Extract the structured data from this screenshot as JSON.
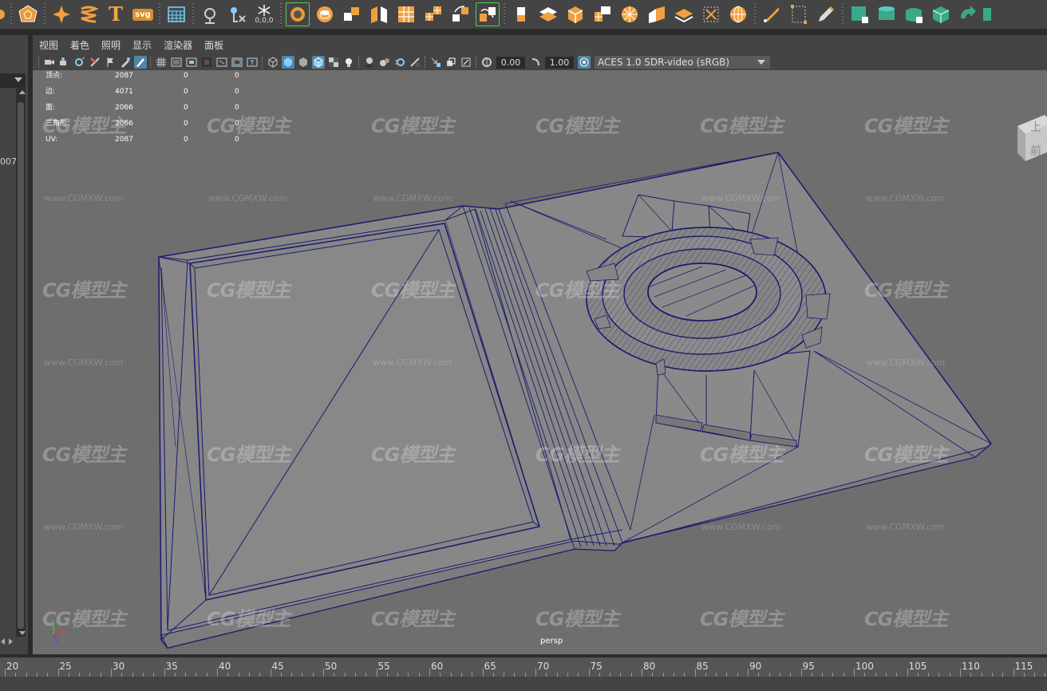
{
  "viewport_menu": [
    "视图",
    "着色",
    "照明",
    "显示",
    "渲染器",
    "面板"
  ],
  "view_fields": {
    "exposure": "0.00",
    "gamma": "1.00",
    "color_space": "ACES 1.0 SDR-video (sRGB)"
  },
  "hud": {
    "rows": [
      {
        "label": "顶点:",
        "v1": "2087",
        "v2": "0",
        "v3": "0"
      },
      {
        "label": "边:",
        "v1": "4071",
        "v2": "0",
        "v3": "0"
      },
      {
        "label": "面:",
        "v1": "2066",
        "v2": "0",
        "v3": "0"
      },
      {
        "label": "三角形:",
        "v1": "2066",
        "v2": "0",
        "v3": "0"
      },
      {
        "label": "UV:",
        "v1": "2087",
        "v2": "0",
        "v3": "0"
      }
    ]
  },
  "camera_label": "persp",
  "left_panel_text": "007",
  "viewcube": {
    "top": "上",
    "front": "前"
  },
  "watermark": {
    "logo": "CG模型主",
    "url": "www.CGMXW.com"
  },
  "timeline": {
    "ticks": [
      "20",
      "25",
      "30",
      "35",
      "40",
      "45",
      "50",
      "55",
      "60",
      "65",
      "70",
      "75",
      "80",
      "85",
      "90",
      "95",
      "100",
      "105",
      "110",
      "115"
    ]
  },
  "shelf_labels": {
    "text_tool": "T",
    "svg_tool": "svg",
    "snap_label": "0,0,0"
  },
  "axis_labels": {
    "y": "y",
    "x": "x",
    "z": "z"
  }
}
